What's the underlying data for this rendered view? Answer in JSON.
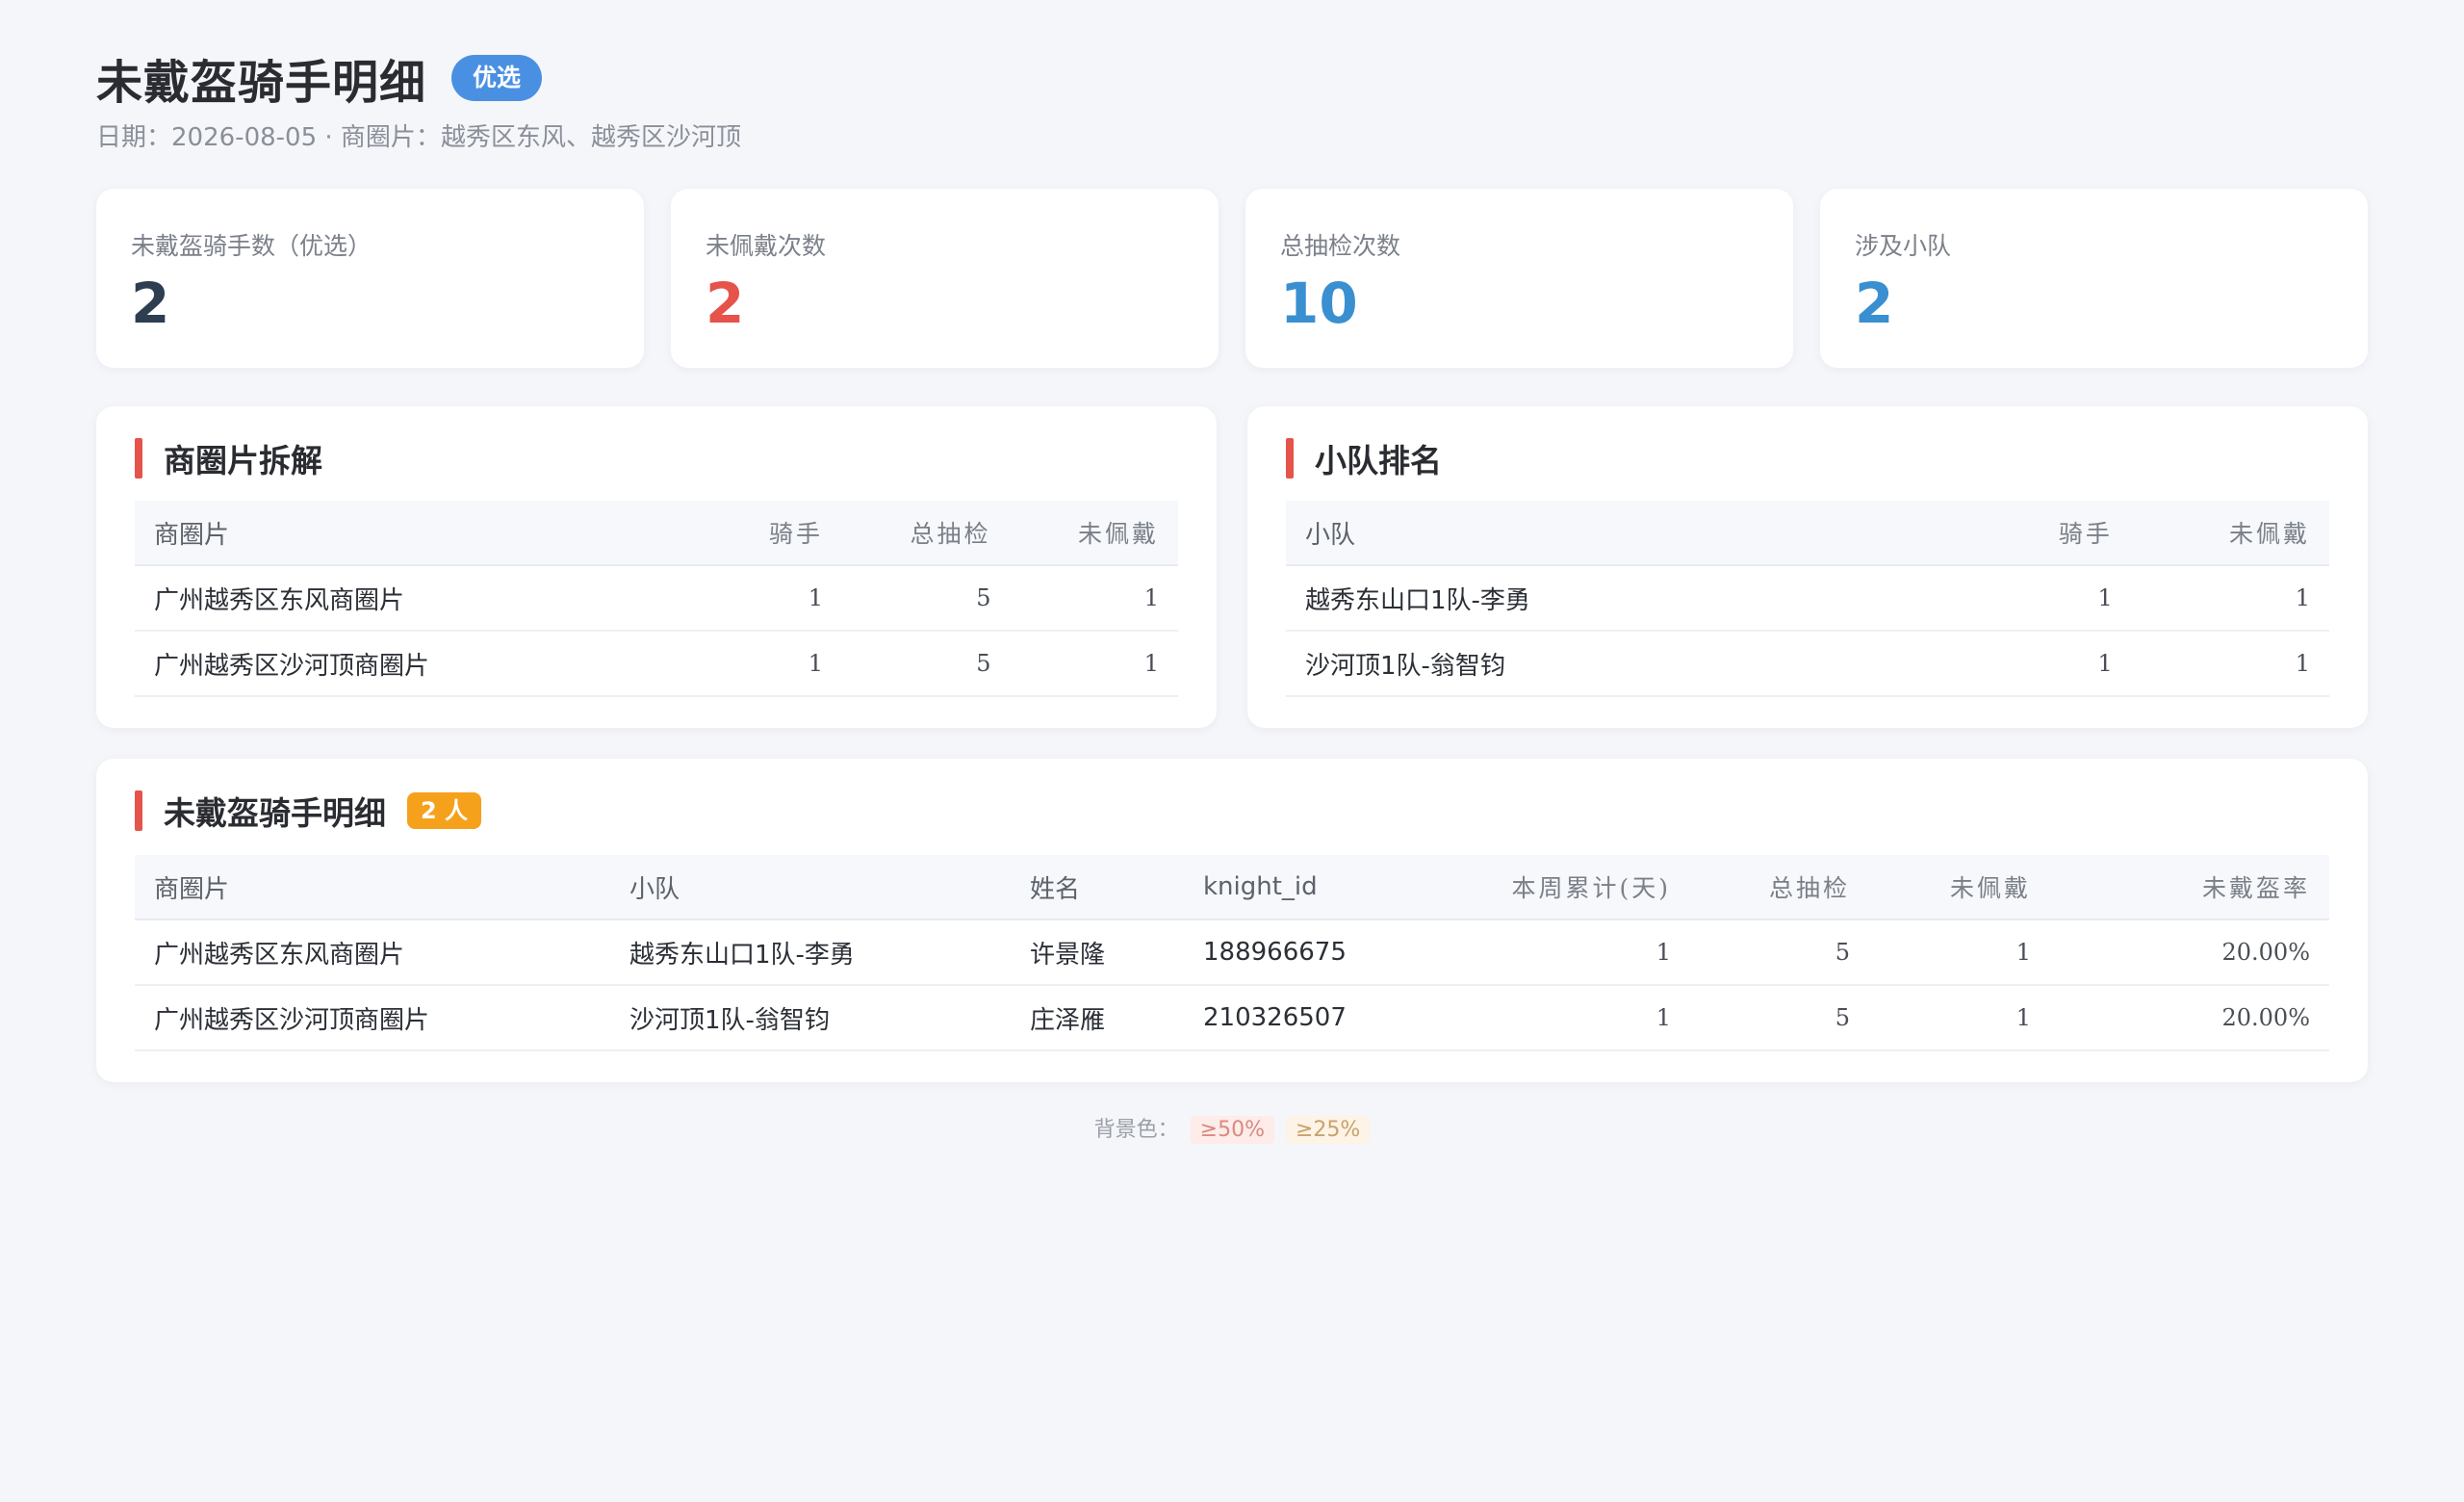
{
  "header": {
    "title": "未戴盔骑手明细",
    "badge": "优选",
    "date_label": "日期：",
    "date": "2026-08-05",
    "separator": " · ",
    "area_label": "商圈片：",
    "areas": "越秀区东风、越秀区沙河顶"
  },
  "stats": [
    {
      "label": "未戴盔骑手数（优选）",
      "value": "2",
      "color": "#2c3e50"
    },
    {
      "label": "未佩戴次数",
      "value": "2",
      "color": "#e5534b"
    },
    {
      "label": "总抽检次数",
      "value": "10",
      "color": "#3a8fd0"
    },
    {
      "label": "涉及小队",
      "value": "2",
      "color": "#3a8fd0"
    }
  ],
  "area_breakdown": {
    "title": "商圈片拆解",
    "columns": [
      "商圈片",
      "骑手",
      "总抽检",
      "未佩戴"
    ],
    "rows": [
      [
        "广州越秀区东风商圈片",
        "1",
        "5",
        "1"
      ],
      [
        "广州越秀区沙河顶商圈片",
        "1",
        "5",
        "1"
      ]
    ]
  },
  "team_ranking": {
    "title": "小队排名",
    "columns": [
      "小队",
      "骑手",
      "未佩戴"
    ],
    "rows": [
      [
        "越秀东山口1队-李勇",
        "1",
        "1"
      ],
      [
        "沙河顶1队-翁智钧",
        "1",
        "1"
      ]
    ]
  },
  "detail": {
    "title": "未戴盔骑手明细",
    "count_badge": "2 人",
    "columns": [
      "商圈片",
      "小队",
      "姓名",
      "knight_id",
      "本周累计(天)",
      "总抽检",
      "未佩戴",
      "未戴盔率"
    ],
    "rows": [
      [
        "广州越秀区东风商圈片",
        "越秀东山口1队-李勇",
        "许景隆",
        "188966675",
        "1",
        "5",
        "1",
        "20.00%"
      ],
      [
        "广州越秀区沙河顶商圈片",
        "沙河顶1队-翁智钧",
        "庄泽雁",
        "210326507",
        "1",
        "5",
        "1",
        "20.00%"
      ]
    ]
  },
  "legend": {
    "label": "背景色：",
    "high": "≥50%",
    "mid": "≥25%"
  }
}
